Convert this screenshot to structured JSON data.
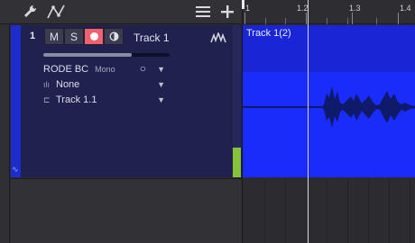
{
  "track": {
    "number": "1",
    "mute_label": "M",
    "solo_label": "S",
    "name": "Track 1",
    "volume_level": 0.7,
    "input": {
      "device": "RODE BC",
      "channel_mode": "Mono"
    },
    "insert": {
      "value": "None"
    },
    "output": {
      "value": "Track 1.1"
    },
    "color": "#1d2ccc"
  },
  "ruler": {
    "labels": [
      "1",
      "1.2",
      "1.3",
      "1.4"
    ]
  },
  "clip": {
    "name": "Track 1(2)",
    "color": "#1a2cfa"
  },
  "icons": [
    "wrench-icon",
    "automation-icon",
    "list-icon",
    "add-icon",
    "record-icon",
    "monitor-icon",
    "waveform-icon",
    "caret-down-icon"
  ]
}
